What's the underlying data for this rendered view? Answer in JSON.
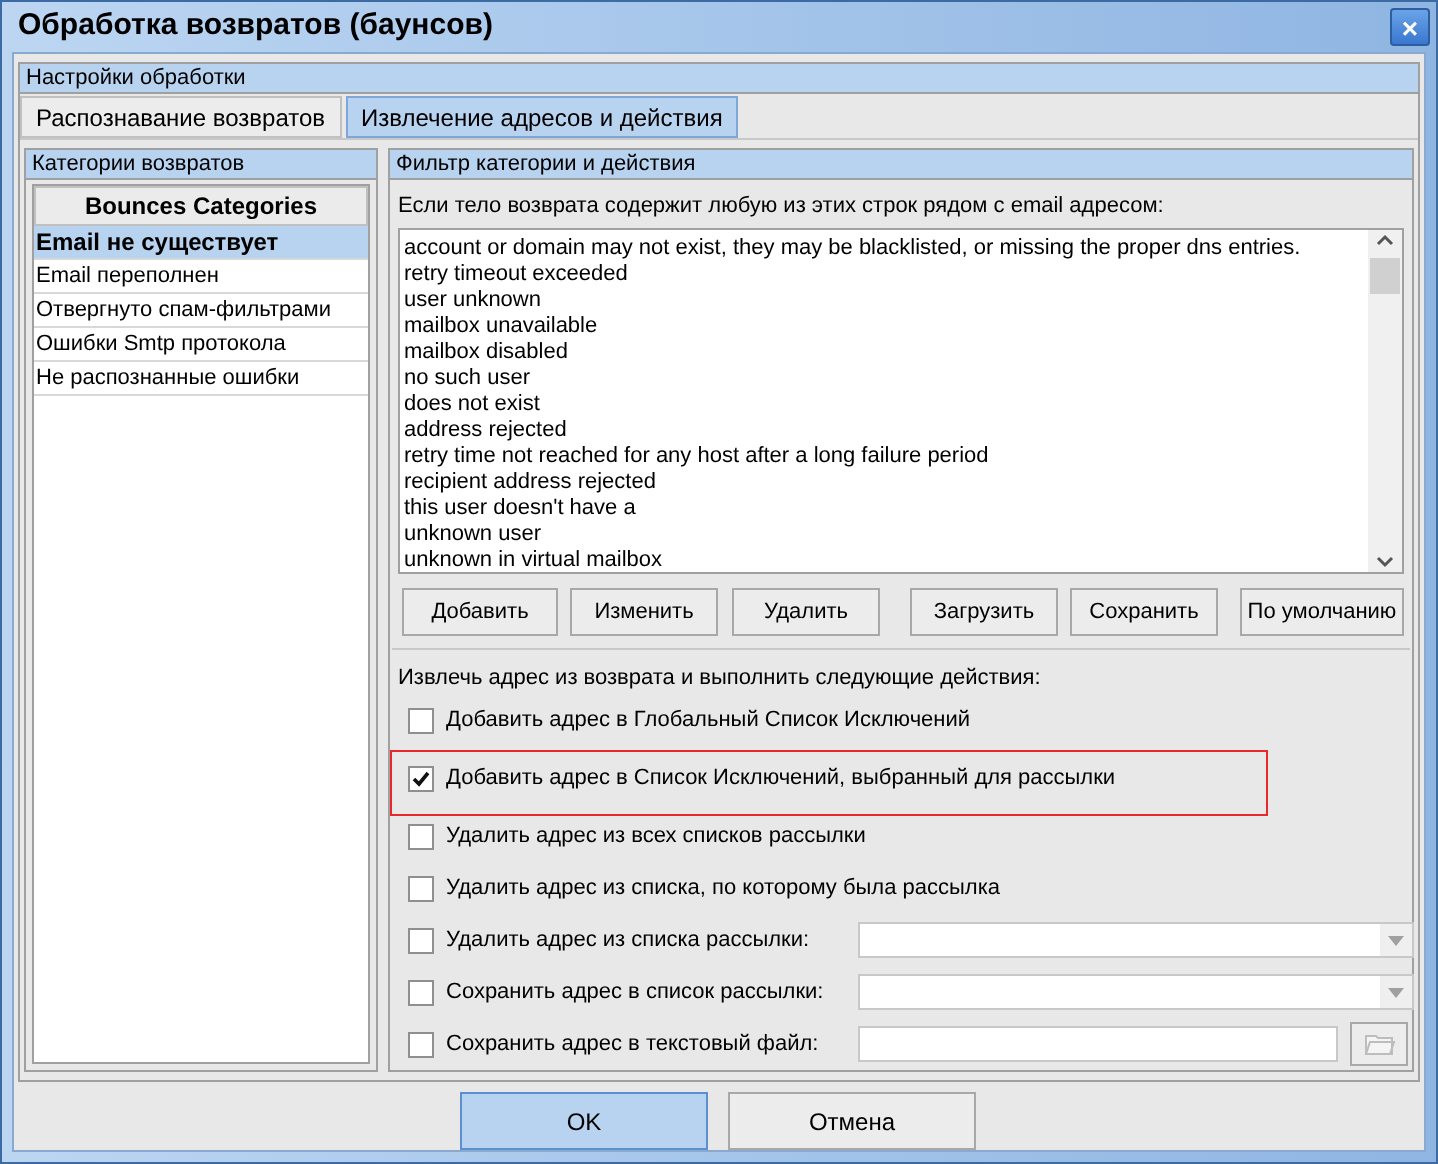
{
  "window": {
    "title": "Обработка возвратов (баунсов)",
    "close": "×"
  },
  "settings_group": {
    "title": "Настройки обработки"
  },
  "tabs": [
    {
      "label": "Распознавание возвратов",
      "selected": false
    },
    {
      "label": "Извлечение адресов и действия",
      "selected": true
    }
  ],
  "categories_panel": {
    "title": "Категории возвратов",
    "column": "Bounces Categories",
    "rows": [
      {
        "label": "Email не существует",
        "selected": true
      },
      {
        "label": "Email переполнен",
        "selected": false
      },
      {
        "label": "Отвергнуто спам-фильтрами",
        "selected": false
      },
      {
        "label": "Ошибки Smtp протокола",
        "selected": false
      },
      {
        "label": "Не распознанные ошибки",
        "selected": false
      }
    ]
  },
  "filter_panel": {
    "title": "Фильтр категории и действия",
    "prompt": "Если тело возврата содержит любую из этих строк рядом с email адресом:",
    "strings": [
      "account or domain may not exist, they may be blacklisted, or missing the proper dns entries.",
      "retry timeout exceeded",
      "user unknown",
      "mailbox unavailable",
      "mailbox disabled",
      "no such user",
      "does not exist",
      "address rejected",
      "retry time not reached for any host after a long failure period",
      "recipient address rejected",
      "this user doesn't have a",
      "unknown user",
      "unknown in virtual mailbox"
    ],
    "buttons": [
      "Добавить",
      "Изменить",
      "Удалить",
      "Загрузить",
      "Сохранить",
      "По умолчанию"
    ],
    "actions_prompt": "Извлечь адрес из возврата и выполнить следующие действия:",
    "actions": [
      {
        "kind": "plain",
        "label": "Добавить адрес в Глобальный Список Исключений",
        "checked": false,
        "highlighted": false
      },
      {
        "kind": "plain",
        "label": "Добавить адрес в Список Исключений, выбранный для рассылки",
        "checked": true,
        "highlighted": true
      },
      {
        "kind": "plain",
        "label": "Удалить адрес из всех списков рассылки",
        "checked": false,
        "highlighted": false
      },
      {
        "kind": "plain",
        "label": "Удалить адрес из списка, по которому была рассылка",
        "checked": false,
        "highlighted": false
      },
      {
        "kind": "dropdown",
        "label": "Удалить адрес из списка рассылки:",
        "checked": false,
        "highlighted": false
      },
      {
        "kind": "dropdown",
        "label": "Сохранить адрес в список рассылки:",
        "checked": false,
        "highlighted": false
      },
      {
        "kind": "file",
        "label": "Сохранить адрес в текстовый файл:",
        "checked": false,
        "highlighted": false
      }
    ]
  },
  "dialog_buttons": [
    {
      "label": "OK",
      "default": true
    },
    {
      "label": "Отмена",
      "default": false
    }
  ]
}
